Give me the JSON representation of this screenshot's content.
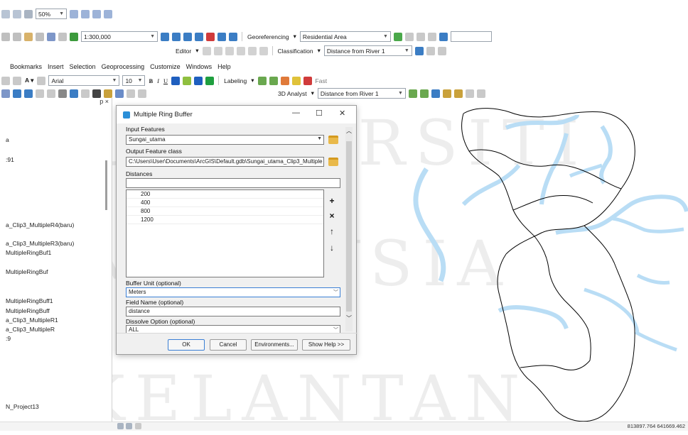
{
  "toolbar": {
    "row1_zoom": "50%",
    "row2_scale": "1:300,000",
    "georef_label": "Georeferencing",
    "georef_layer": "Residential Area",
    "editor_label": "Editor",
    "classification_label": "Classification",
    "classification_layer": "Distance from River 1",
    "menu": [
      "Bookmarks",
      "Insert",
      "Selection",
      "Geoprocessing",
      "Customize",
      "Windows",
      "Help"
    ],
    "font_name": "Arial",
    "font_size": "10",
    "bold": "B",
    "italic": "I",
    "underline": "U",
    "labeling_label": "Labeling",
    "labeling_speed": "Fast",
    "analyst_label": "3D Analyst",
    "analyst_layer": "Distance from River 1",
    "accent_color": "#1f5fbf"
  },
  "toc": {
    "pin_close": "p ×",
    "items": [
      "a",
      ":91",
      "a_Clip3_MultipleR4(baru)",
      "a_Clip3_MultipleR3(baru)",
      "MultipleRingBuf1",
      "MultipleRingBuf",
      "MultipleRingBuff1",
      "MultipleRingBuff",
      "a_Clip3_MultipleR1",
      "a_Clip3_MultipleR",
      ":9",
      "N_Project13"
    ]
  },
  "dialog": {
    "title": "Multiple Ring Buffer",
    "minimize": "—",
    "maximize": "☐",
    "close": "✕",
    "input_features_label": "Input Features",
    "input_features_value": "Sungai_utama",
    "output_class_label": "Output Feature class",
    "output_class_value": "C:\\Users\\User\\Documents\\ArcGIS\\Default.gdb\\Sungai_utama_Clip3_Multiple",
    "distances_label": "Distances",
    "distances": [
      "200",
      "400",
      "800",
      "1200"
    ],
    "add_button": "+",
    "remove_button": "×",
    "up_button": "↑",
    "down_button": "↓",
    "buffer_unit_label": "Buffer Unit (optional)",
    "buffer_unit_value": "Meters",
    "field_name_label": "Field Name (optional)",
    "field_name_value": "distance",
    "dissolve_label": "Dissolve Option (optional)",
    "dissolve_value": "ALL",
    "ok": "OK",
    "cancel": "Cancel",
    "environments": "Environments...",
    "show_help": "Show Help >>"
  },
  "status": {
    "coordinates": "813897.764 641669.462"
  },
  "watermark": [
    "UNIVERSITI",
    "MALAYSIA",
    "KELANTAN"
  ],
  "colors": {
    "river": "#b9ddf5",
    "boundary": "#000000"
  }
}
